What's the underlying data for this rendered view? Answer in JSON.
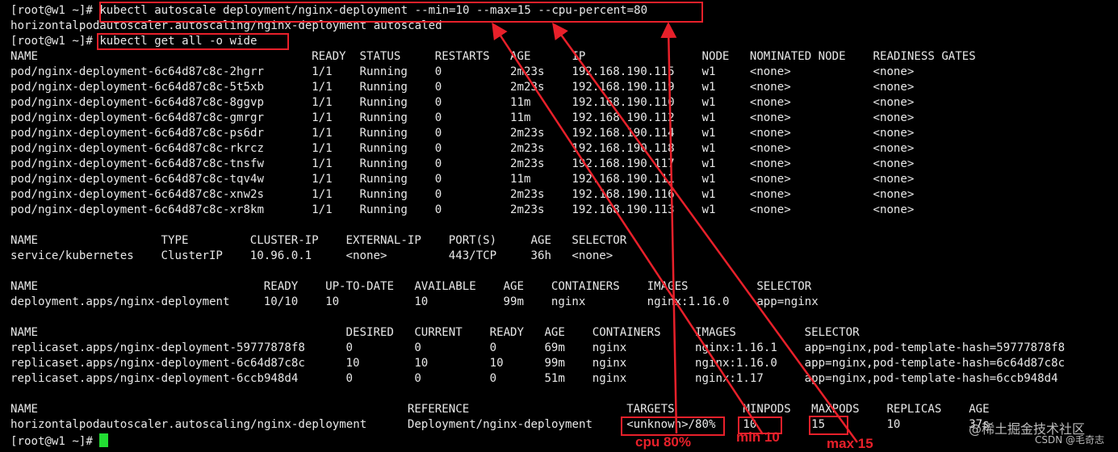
{
  "terminal": {
    "line0": {
      "prompt": "[root@w1 ~]# ",
      "cmd": "kubectl autoscale deployment/nginx-deployment --min=10 --max=15 --cpu-percent=80"
    },
    "line1": "horizontalpodautoscaler.autoscaling/nginx-deployment autoscaled",
    "line2": {
      "prompt": "[root@w1 ~]# ",
      "cmd": "kubectl get all -o wide"
    },
    "pods": {
      "headers": [
        "NAME",
        "READY",
        "STATUS",
        "RESTARTS",
        "AGE",
        "IP",
        "NODE",
        "NOMINATED NODE",
        "READINESS GATES"
      ],
      "rows": [
        [
          "pod/nginx-deployment-6c64d87c8c-2hgrr",
          "1/1",
          "Running",
          "0",
          "2m23s",
          "192.168.190.115",
          "w1",
          "<none>",
          "<none>"
        ],
        [
          "pod/nginx-deployment-6c64d87c8c-5t5xb",
          "1/1",
          "Running",
          "0",
          "2m23s",
          "192.168.190.119",
          "w1",
          "<none>",
          "<none>"
        ],
        [
          "pod/nginx-deployment-6c64d87c8c-8ggvp",
          "1/1",
          "Running",
          "0",
          "11m",
          "192.168.190.110",
          "w1",
          "<none>",
          "<none>"
        ],
        [
          "pod/nginx-deployment-6c64d87c8c-gmrgr",
          "1/1",
          "Running",
          "0",
          "11m",
          "192.168.190.112",
          "w1",
          "<none>",
          "<none>"
        ],
        [
          "pod/nginx-deployment-6c64d87c8c-ps6dr",
          "1/1",
          "Running",
          "0",
          "2m23s",
          "192.168.190.114",
          "w1",
          "<none>",
          "<none>"
        ],
        [
          "pod/nginx-deployment-6c64d87c8c-rkrcz",
          "1/1",
          "Running",
          "0",
          "2m23s",
          "192.168.190.118",
          "w1",
          "<none>",
          "<none>"
        ],
        [
          "pod/nginx-deployment-6c64d87c8c-tnsfw",
          "1/1",
          "Running",
          "0",
          "2m23s",
          "192.168.190.117",
          "w1",
          "<none>",
          "<none>"
        ],
        [
          "pod/nginx-deployment-6c64d87c8c-tqv4w",
          "1/1",
          "Running",
          "0",
          "11m",
          "192.168.190.111",
          "w1",
          "<none>",
          "<none>"
        ],
        [
          "pod/nginx-deployment-6c64d87c8c-xnw2s",
          "1/1",
          "Running",
          "0",
          "2m23s",
          "192.168.190.116",
          "w1",
          "<none>",
          "<none>"
        ],
        [
          "pod/nginx-deployment-6c64d87c8c-xr8km",
          "1/1",
          "Running",
          "0",
          "2m23s",
          "192.168.190.113",
          "w1",
          "<none>",
          "<none>"
        ]
      ]
    },
    "services": {
      "headers": [
        "NAME",
        "TYPE",
        "CLUSTER-IP",
        "EXTERNAL-IP",
        "PORT(S)",
        "AGE",
        "SELECTOR"
      ],
      "rows": [
        [
          "service/kubernetes",
          "ClusterIP",
          "10.96.0.1",
          "<none>",
          "443/TCP",
          "36h",
          "<none>"
        ]
      ]
    },
    "deployments": {
      "headers": [
        "NAME",
        "READY",
        "UP-TO-DATE",
        "AVAILABLE",
        "AGE",
        "CONTAINERS",
        "IMAGES",
        "SELECTOR"
      ],
      "rows": [
        [
          "deployment.apps/nginx-deployment",
          "10/10",
          "10",
          "10",
          "99m",
          "nginx",
          "nginx:1.16.0",
          "app=nginx"
        ]
      ]
    },
    "replicasets": {
      "headers": [
        "NAME",
        "DESIRED",
        "CURRENT",
        "READY",
        "AGE",
        "CONTAINERS",
        "IMAGES",
        "SELECTOR"
      ],
      "rows": [
        [
          "replicaset.apps/nginx-deployment-59777878f8",
          "0",
          "0",
          "0",
          "69m",
          "nginx",
          "nginx:1.16.1",
          "app=nginx,pod-template-hash=59777878f8"
        ],
        [
          "replicaset.apps/nginx-deployment-6c64d87c8c",
          "10",
          "10",
          "10",
          "99m",
          "nginx",
          "nginx:1.16.0",
          "app=nginx,pod-template-hash=6c64d87c8c"
        ],
        [
          "replicaset.apps/nginx-deployment-6ccb948d4",
          "0",
          "0",
          "0",
          "51m",
          "nginx",
          "nginx:1.17",
          "app=nginx,pod-template-hash=6ccb948d4"
        ]
      ]
    },
    "hpa": {
      "headers": [
        "NAME",
        "REFERENCE",
        "TARGETS",
        "MINPODS",
        "MAXPODS",
        "REPLICAS",
        "AGE"
      ],
      "rows": [
        [
          "horizontalpodautoscaler.autoscaling/nginx-deployment",
          "Deployment/nginx-deployment",
          "<unknown>/80%",
          "10",
          "15",
          "10",
          "37s"
        ]
      ]
    },
    "final_prompt": "[root@w1 ~]# "
  },
  "annotations": {
    "color": "#e8202a",
    "labels": {
      "cpu": "cpu 80%",
      "min": "min 10",
      "max": "max 15"
    }
  },
  "watermark": {
    "site": "@稀土掘金技术社区",
    "author": "CSDN @毛奇志"
  }
}
